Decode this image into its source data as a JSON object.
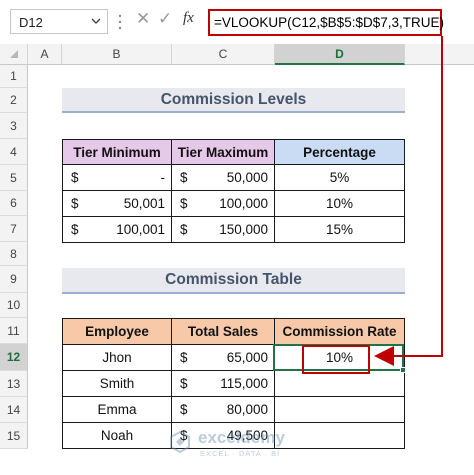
{
  "formula_bar": {
    "name_box": "D12",
    "cancel_symbol": "✕",
    "enter_symbol": "✓",
    "function_symbol": "fx",
    "formula": "=VLOOKUP(C12,$B$5:$D$7,3,TRUE)"
  },
  "columns": [
    "A",
    "B",
    "C",
    "D"
  ],
  "rows": [
    "1",
    "2",
    "3",
    "4",
    "5",
    "6",
    "7",
    "8",
    "9",
    "10",
    "11",
    "12",
    "13",
    "14",
    "15"
  ],
  "selected_cell": {
    "column": "D",
    "row": "12"
  },
  "commission_levels": {
    "title": "Commission Levels",
    "headers": [
      "Tier Minimum",
      "Tier Maximum",
      "Percentage"
    ],
    "rows": [
      {
        "min_symbol": "$",
        "min": "-",
        "max_symbol": "$",
        "max": "50,000",
        "percentage": "5%"
      },
      {
        "min_symbol": "$",
        "min": "50,001",
        "max_symbol": "$",
        "max": "100,000",
        "percentage": "10%"
      },
      {
        "min_symbol": "$",
        "min": "100,001",
        "max_symbol": "$",
        "max": "150,000",
        "percentage": "15%"
      }
    ]
  },
  "commission_table": {
    "title": "Commission Table",
    "headers": [
      "Employee",
      "Total Sales",
      "Commission Rate"
    ],
    "rows": [
      {
        "employee": "Jhon",
        "sales_symbol": "$",
        "sales": "65,000",
        "rate": "10%"
      },
      {
        "employee": "Smith",
        "sales_symbol": "$",
        "sales": "115,000",
        "rate": ""
      },
      {
        "employee": "Emma",
        "sales_symbol": "$",
        "sales": "80,000",
        "rate": ""
      },
      {
        "employee": "Noah",
        "sales_symbol": "$",
        "sales": "49,500",
        "rate": ""
      }
    ]
  },
  "watermark": {
    "name": "exceldemy",
    "tagline": "EXCEL · DATA · BI"
  },
  "colors": {
    "annotation_red": "#c00000",
    "excel_green": "#217346",
    "title_text": "#44546a",
    "header_purple": "#e6c8e8",
    "header_blue": "#c9dcf3",
    "header_orange": "#f7c9a8"
  }
}
